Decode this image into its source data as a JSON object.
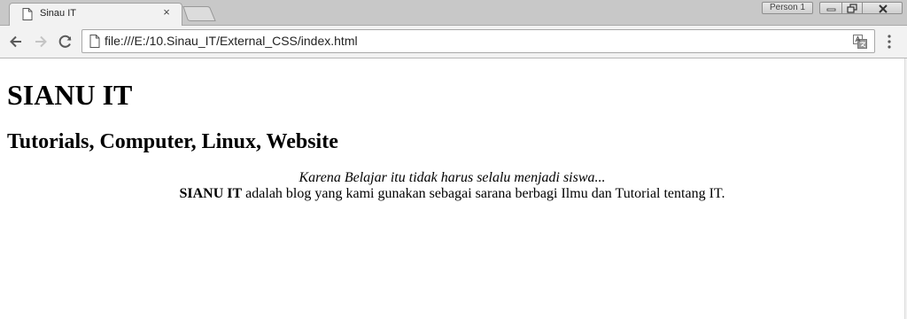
{
  "browser": {
    "tab": {
      "title": "Sinau IT",
      "close_glyph": "×"
    },
    "profile_label": "Person 1",
    "address_bar": {
      "url": "file:///E:/10.Sinau_IT/External_CSS/index.html"
    },
    "icons": {
      "tab_favicon": "page-icon",
      "back": "arrow-left-icon",
      "forward": "arrow-right-icon",
      "reload": "reload-icon",
      "translate": "translate-icon",
      "menu": "vertical-dots-icon"
    }
  },
  "page": {
    "heading": "SIANU IT",
    "subheading": "Tutorials, Computer, Linux, Website",
    "tagline": "Karena Belajar itu tidak harus selalu menjadi siswa...",
    "description_bold": "SIANU IT",
    "description_rest": " adalah blog yang kami gunakan sebagai sarana berbagi Ilmu dan Tutorial tentang IT."
  },
  "colors": {
    "tabstrip_bg": "#c8c8c8",
    "toolbar_bg": "#f2f2f2",
    "page_bg": "#ffffff",
    "text": "#000000"
  }
}
